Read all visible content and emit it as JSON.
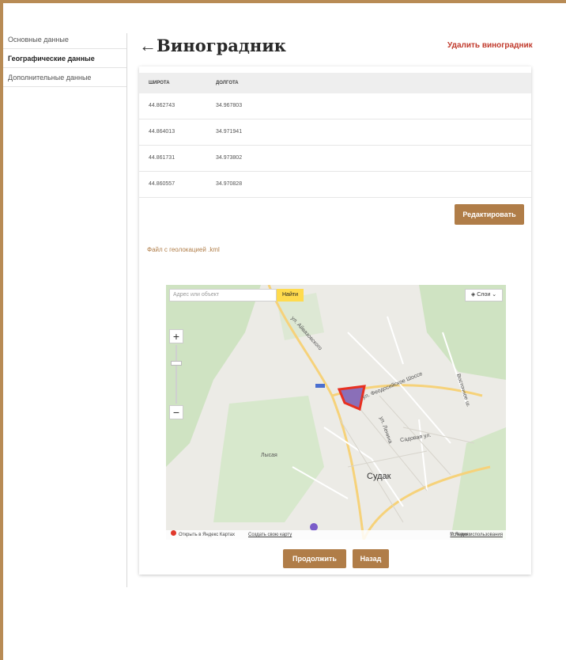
{
  "sidebar": {
    "items": [
      {
        "label": "Основные данные"
      },
      {
        "label": "Географические данные"
      },
      {
        "label": "Дополнительные данные"
      }
    ]
  },
  "header": {
    "back_icon": "←",
    "title": "Виноградник",
    "delete_label": "Удалить виноградник"
  },
  "table": {
    "columns": [
      "Широта",
      "Долгота"
    ],
    "rows": [
      [
        "44.862743",
        "34.967803"
      ],
      [
        "44.864013",
        "34.971941"
      ],
      [
        "44.861731",
        "34.973802"
      ],
      [
        "44.860557",
        "34.970828"
      ]
    ]
  },
  "actions": {
    "edit_label": "Редактировать",
    "kml_link": "Файл с геолокацией .kml",
    "continue_label": "Продолжить",
    "back_label": "Назад"
  },
  "map": {
    "search_placeholder": "Адрес или объект",
    "find_label": "Найти",
    "layers_label": "Слои",
    "zoom_in": "+",
    "zoom_out": "−",
    "city": "Судак",
    "labels": [
      "ул. Айвазовского",
      "ул. Феодосийское Шоссе",
      "ул. Ленина",
      "Лысая",
      "Садовая ул.",
      "Восточное ш."
    ],
    "footer_open": "Открыть в Яндекс Картах",
    "footer_create": "Создать свою карту",
    "footer_copyright": "© Яндекс",
    "footer_terms": "Условия использования",
    "polygon_color": "#c0392b",
    "accent": "#b07d48"
  }
}
